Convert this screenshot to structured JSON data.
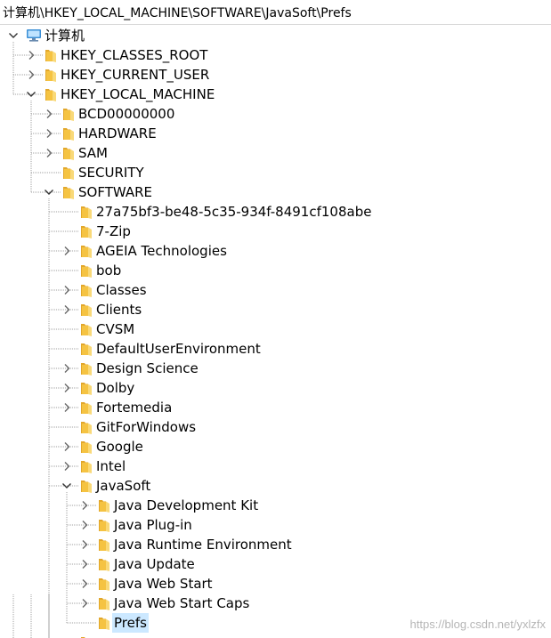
{
  "address_bar": {
    "path": "计算机\\HKEY_LOCAL_MACHINE\\SOFTWARE\\JavaSoft\\Prefs"
  },
  "colors": {
    "folder": "#f5c342",
    "selection": "#cce8ff",
    "guide": "#a0a0a0"
  },
  "tree": [
    {
      "label": "计算机",
      "depth": 0,
      "state": "expanded",
      "icon": "computer-icon"
    },
    {
      "label": "HKEY_CLASSES_ROOT",
      "depth": 1,
      "state": "collapsed",
      "icon": "folder-icon"
    },
    {
      "label": "HKEY_CURRENT_USER",
      "depth": 1,
      "state": "collapsed",
      "icon": "folder-icon"
    },
    {
      "label": "HKEY_LOCAL_MACHINE",
      "depth": 1,
      "state": "expanded",
      "icon": "folder-icon"
    },
    {
      "label": "BCD00000000",
      "depth": 2,
      "state": "collapsed",
      "icon": "folder-icon"
    },
    {
      "label": "HARDWARE",
      "depth": 2,
      "state": "collapsed",
      "icon": "folder-icon"
    },
    {
      "label": "SAM",
      "depth": 2,
      "state": "collapsed",
      "icon": "folder-icon"
    },
    {
      "label": "SECURITY",
      "depth": 2,
      "state": "leaf",
      "icon": "folder-icon"
    },
    {
      "label": "SOFTWARE",
      "depth": 2,
      "state": "expanded",
      "icon": "folder-icon"
    },
    {
      "label": "27a75bf3-be48-5c35-934f-8491cf108abe",
      "depth": 3,
      "state": "leaf",
      "icon": "folder-icon"
    },
    {
      "label": "7-Zip",
      "depth": 3,
      "state": "leaf",
      "icon": "folder-icon"
    },
    {
      "label": "AGEIA Technologies",
      "depth": 3,
      "state": "collapsed",
      "icon": "folder-icon"
    },
    {
      "label": "bob",
      "depth": 3,
      "state": "leaf",
      "icon": "folder-icon"
    },
    {
      "label": "Classes",
      "depth": 3,
      "state": "collapsed",
      "icon": "folder-icon"
    },
    {
      "label": "Clients",
      "depth": 3,
      "state": "collapsed",
      "icon": "folder-icon"
    },
    {
      "label": "CVSM",
      "depth": 3,
      "state": "leaf",
      "icon": "folder-icon"
    },
    {
      "label": "DefaultUserEnvironment",
      "depth": 3,
      "state": "leaf",
      "icon": "folder-icon"
    },
    {
      "label": "Design Science",
      "depth": 3,
      "state": "collapsed",
      "icon": "folder-icon"
    },
    {
      "label": "Dolby",
      "depth": 3,
      "state": "collapsed",
      "icon": "folder-icon"
    },
    {
      "label": "Fortemedia",
      "depth": 3,
      "state": "collapsed",
      "icon": "folder-icon"
    },
    {
      "label": "GitForWindows",
      "depth": 3,
      "state": "leaf",
      "icon": "folder-icon"
    },
    {
      "label": "Google",
      "depth": 3,
      "state": "collapsed",
      "icon": "folder-icon"
    },
    {
      "label": "Intel",
      "depth": 3,
      "state": "collapsed",
      "icon": "folder-icon"
    },
    {
      "label": "JavaSoft",
      "depth": 3,
      "state": "expanded",
      "icon": "folder-icon"
    },
    {
      "label": "Java Development Kit",
      "depth": 4,
      "state": "collapsed",
      "icon": "folder-icon"
    },
    {
      "label": "Java Plug-in",
      "depth": 4,
      "state": "collapsed",
      "icon": "folder-icon"
    },
    {
      "label": "Java Runtime Environment",
      "depth": 4,
      "state": "collapsed",
      "icon": "folder-icon"
    },
    {
      "label": "Java Update",
      "depth": 4,
      "state": "collapsed",
      "icon": "folder-icon"
    },
    {
      "label": "Java Web Start",
      "depth": 4,
      "state": "collapsed",
      "icon": "folder-icon"
    },
    {
      "label": "Java Web Start Caps",
      "depth": 4,
      "state": "collapsed",
      "icon": "folder-icon"
    },
    {
      "label": "Prefs",
      "depth": 4,
      "state": "leaf",
      "icon": "folder-icon",
      "selected": true
    },
    {
      "label": "",
      "depth": 3,
      "state": "leaf",
      "icon": "folder-icon"
    }
  ],
  "watermark": "https://blog.csdn.net/yxlzfx"
}
